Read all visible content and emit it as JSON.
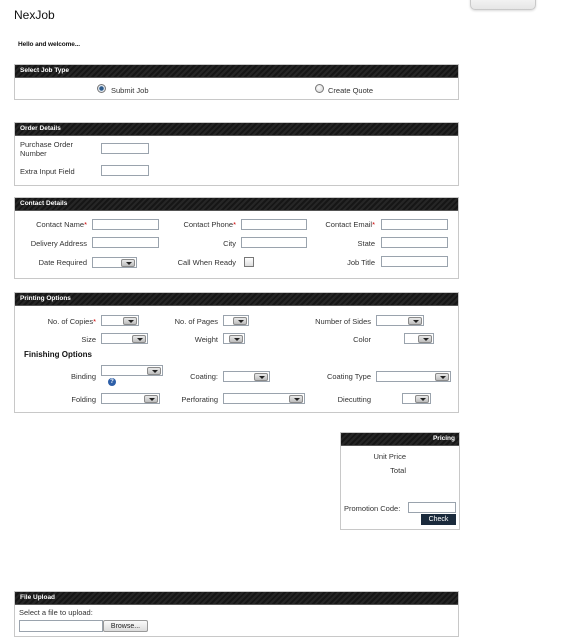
{
  "app": {
    "title": "NexJob",
    "welcome": "Hello and welcome..."
  },
  "job_type": {
    "header": "Select Job Type",
    "options": [
      {
        "label": "Submit Job",
        "selected": true
      },
      {
        "label": "Create Quote",
        "selected": false
      }
    ]
  },
  "order_details": {
    "header": "Order Details",
    "purchase_order_line1": "Purchase Order",
    "purchase_order_line2": "Number",
    "extra_input": "Extra Input Field"
  },
  "contact_details": {
    "header": "Contact Details",
    "contact_name": "Contact Name",
    "contact_phone": "Contact Phone",
    "contact_email": "Contact Email",
    "delivery_address": "Delivery Address",
    "city": "City",
    "state": "State",
    "date_required": "Date Required",
    "call_when_ready": "Call When Ready",
    "job_title": "Job Title",
    "required_marker": "*"
  },
  "printing_options": {
    "header": "Printing Options",
    "copies": "No. of Copies",
    "pages": "No. of Pages",
    "sides": "Number of Sides",
    "size": "Size",
    "weight": "Weight",
    "color": "Color",
    "finishing_title": "Finishing Options",
    "binding": "Binding",
    "coating": "Coating:",
    "coating_type": "Coating Type",
    "folding": "Folding",
    "perforating": "Perforating",
    "diecutting": "Diecutting",
    "help_glyph": "?"
  },
  "pricing": {
    "header": "Pricing",
    "unit_price": "Unit Price",
    "total": "Total",
    "promo_label": "Promotion Code:",
    "check_button": "Check"
  },
  "file_upload": {
    "header": "File Upload",
    "prompt": "Select a file to upload:",
    "browse_button": "Browse..."
  }
}
